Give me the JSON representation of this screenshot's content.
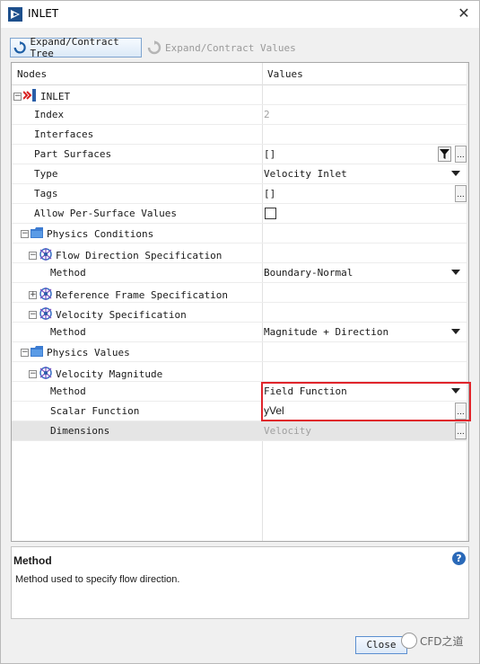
{
  "window": {
    "title": "INLET",
    "close_icon": "close-icon"
  },
  "toolbar": {
    "expand_tree_label": "Expand/Contract Tree",
    "expand_values_label": "Expand/Contract Values"
  },
  "tree": {
    "headers": {
      "nodes": "Nodes",
      "values": "Values"
    },
    "rows": [
      {
        "label": "INLET",
        "value": ""
      },
      {
        "label": "Index",
        "value": "2"
      },
      {
        "label": "Interfaces",
        "value": ""
      },
      {
        "label": "Part Surfaces",
        "value": "[]"
      },
      {
        "label": "Type",
        "value": "Velocity Inlet"
      },
      {
        "label": "Tags",
        "value": "[]"
      },
      {
        "label": "Allow Per-Surface Values",
        "value": ""
      },
      {
        "label": "Physics Conditions",
        "value": ""
      },
      {
        "label": "Flow Direction Specification",
        "value": ""
      },
      {
        "label": "Method",
        "value": "Boundary-Normal"
      },
      {
        "label": "Reference Frame Specification",
        "value": ""
      },
      {
        "label": "Velocity Specification",
        "value": ""
      },
      {
        "label": "Method",
        "value": "Magnitude + Direction"
      },
      {
        "label": "Physics Values",
        "value": ""
      },
      {
        "label": "Velocity Magnitude",
        "value": ""
      },
      {
        "label": "Method",
        "value": "Field Function"
      },
      {
        "label": "Scalar Function",
        "value": "yVel"
      },
      {
        "label": "Dimensions",
        "value": "Velocity"
      }
    ]
  },
  "description": {
    "title": "Method",
    "text": "Method used to specify flow direction."
  },
  "footer": {
    "close_label": "Close",
    "watermark": "CFD之道"
  },
  "colors": {
    "highlight": "#e0242b",
    "accent": "#2a69b8"
  }
}
